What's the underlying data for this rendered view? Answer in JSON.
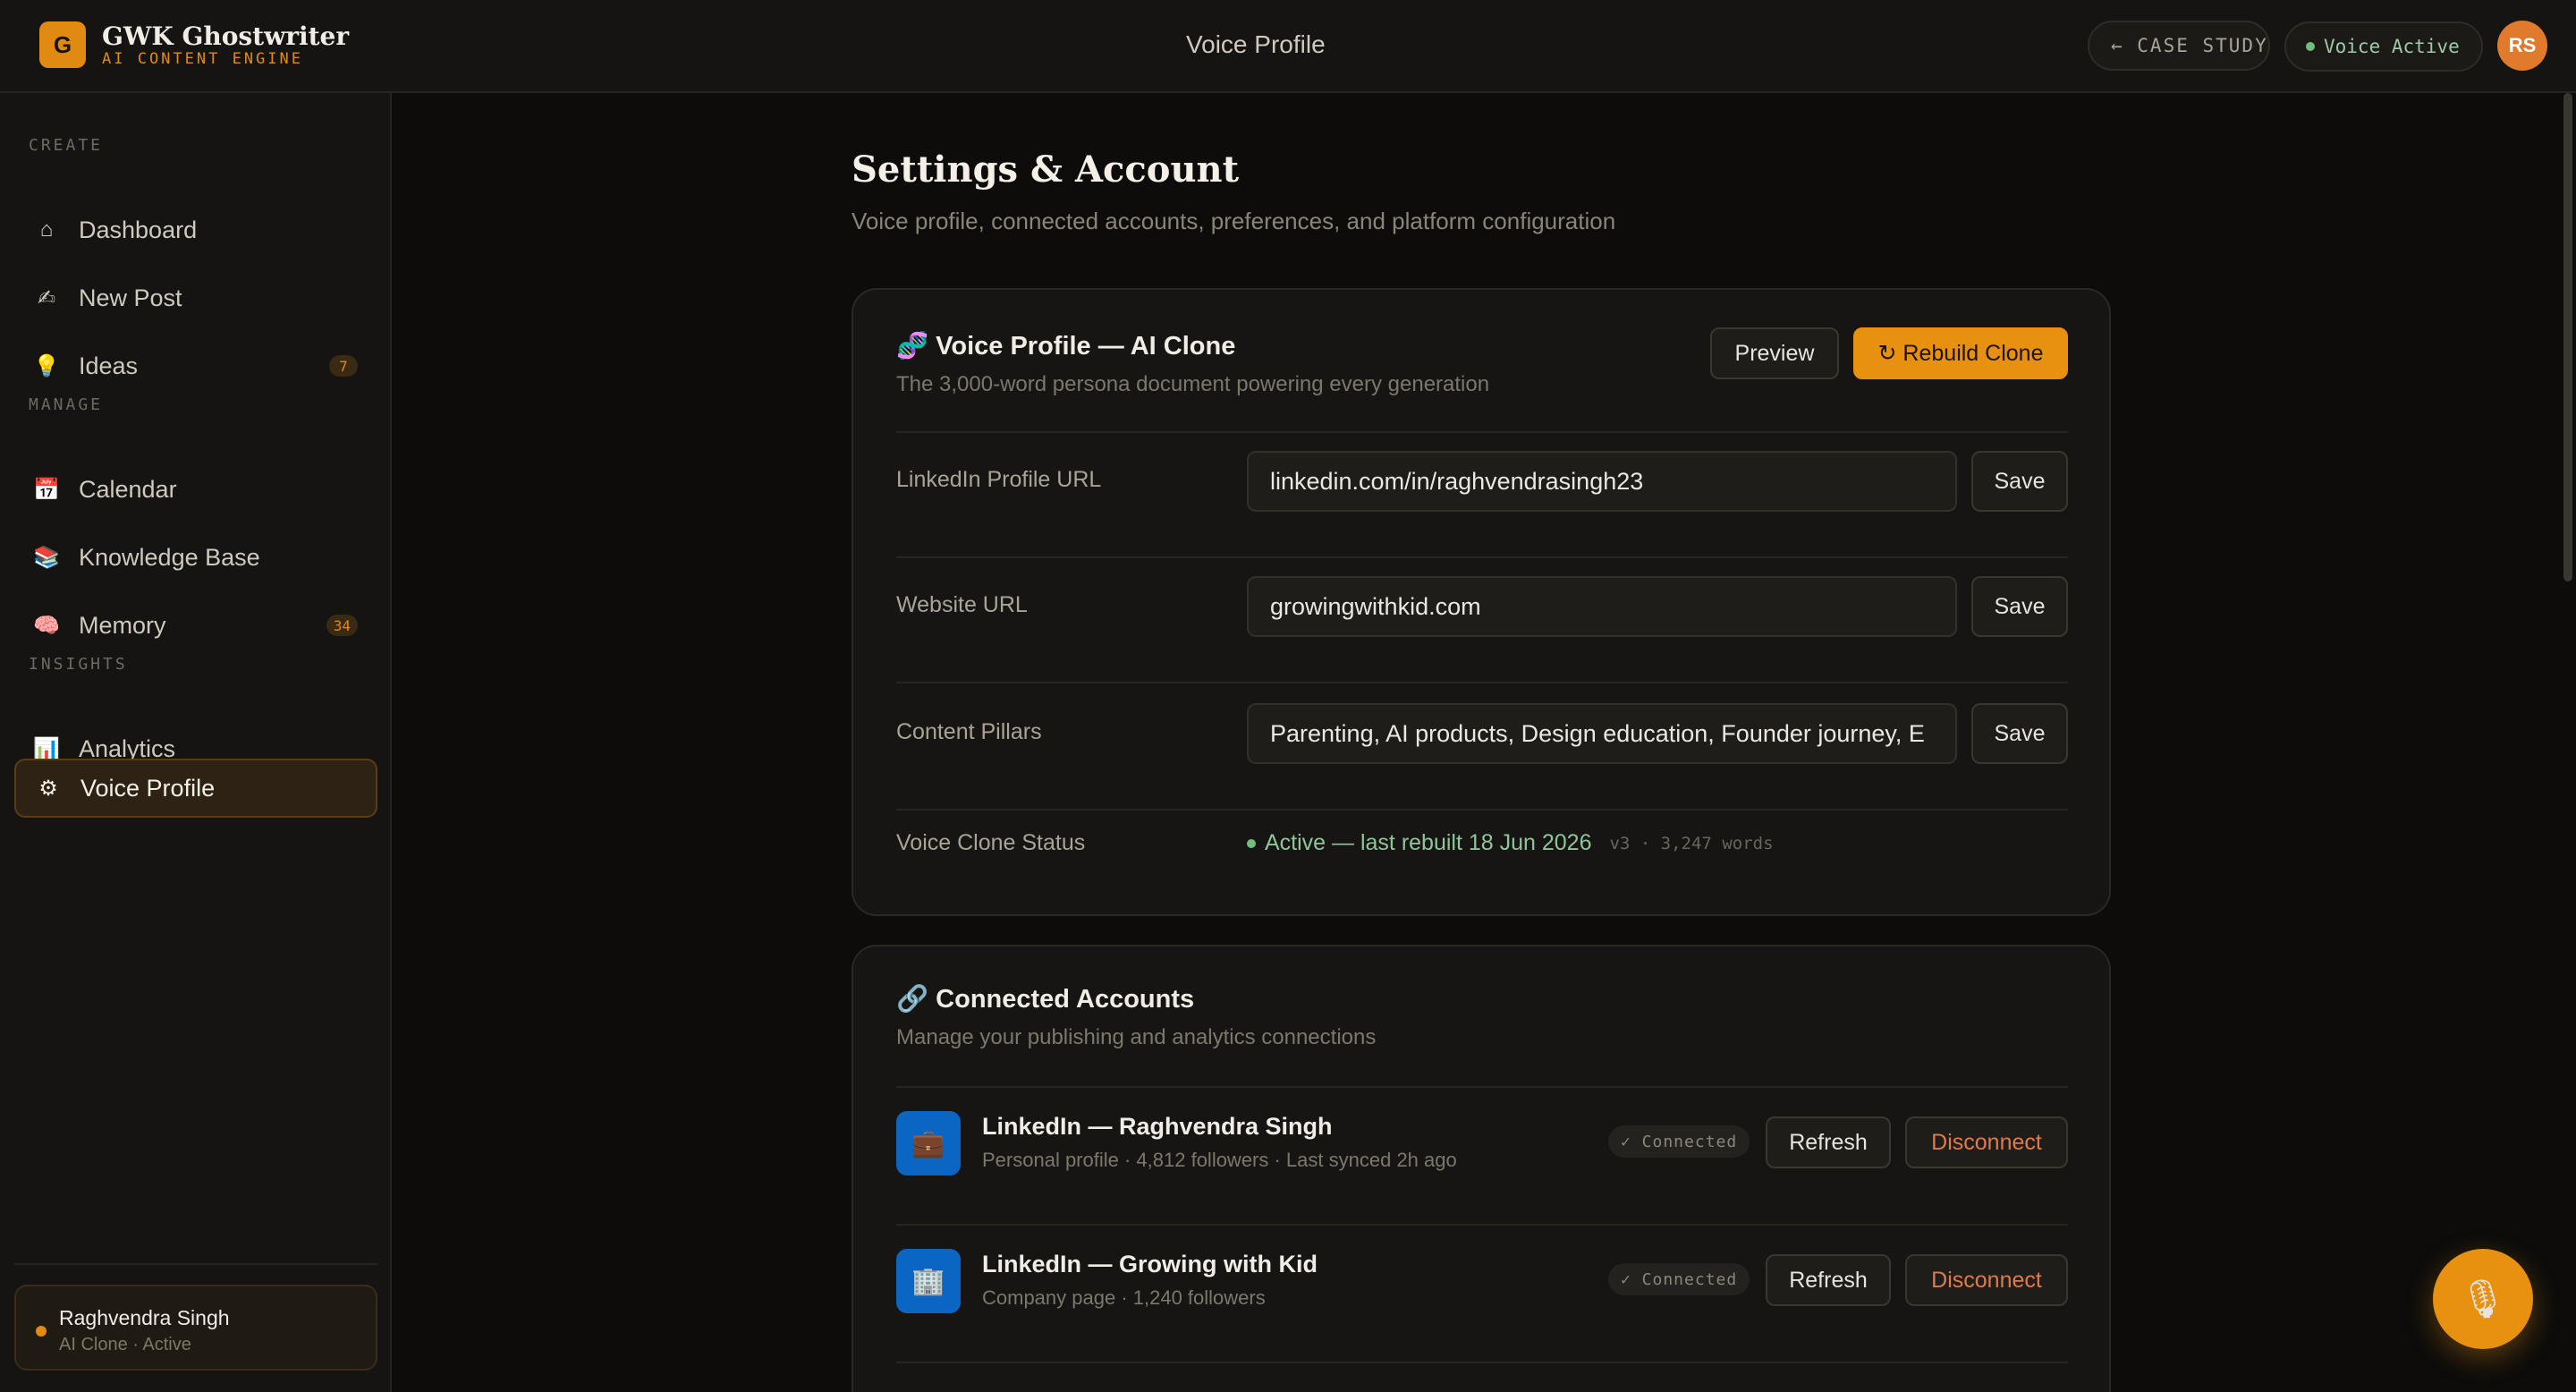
{
  "app": {
    "logo_letter": "G",
    "name": "GWK Ghostwriter",
    "tagline": "AI CONTENT ENGINE",
    "page_title": "Voice Profile",
    "case_study_label": "← CASE STUDY",
    "voice_status_label": "Voice Active",
    "avatar_initials": "RS"
  },
  "sidebar": {
    "sections": [
      {
        "label": "CREATE"
      },
      {
        "label": "MANAGE"
      },
      {
        "label": "INSIGHTS"
      }
    ],
    "items": [
      {
        "label": "Dashboard",
        "icon": "home-icon",
        "glyph": "⌂"
      },
      {
        "label": "New Post",
        "icon": "writing-hand-icon",
        "glyph": "✍"
      },
      {
        "label": "Ideas",
        "icon": "lightbulb-icon",
        "glyph": "💡",
        "badge": "7"
      },
      {
        "label": "Calendar",
        "icon": "calendar-icon",
        "glyph": "📅"
      },
      {
        "label": "Knowledge Base",
        "icon": "books-icon",
        "glyph": "📚"
      },
      {
        "label": "Memory",
        "icon": "brain-icon",
        "glyph": "🧠",
        "badge": "34"
      },
      {
        "label": "Analytics",
        "icon": "bar-chart-icon",
        "glyph": "📊"
      },
      {
        "label": "Voice Profile",
        "icon": "gear-icon",
        "glyph": "⚙",
        "active": true
      }
    ],
    "user": {
      "name": "Raghvendra Singh",
      "status": "AI Clone · Active"
    }
  },
  "main": {
    "title": "Settings & Account",
    "subtitle": "Voice profile, connected accounts, preferences, and platform configuration",
    "voice_card": {
      "icon": "dna-icon",
      "icon_glyph": "🧬",
      "title": "Voice Profile — AI Clone",
      "subtitle": "The 3,000-word persona document powering every generation",
      "preview_label": "Preview",
      "rebuild_label": "↻ Rebuild Clone",
      "fields": [
        {
          "label": "LinkedIn Profile URL",
          "value": "linkedin.com/in/raghvendrasingh23",
          "save_label": "Save"
        },
        {
          "label": "Website URL",
          "value": "growingwithkid.com",
          "save_label": "Save"
        },
        {
          "label": "Content Pillars",
          "value": "Parenting, AI products, Design education, Founder journey, E",
          "save_label": "Save"
        }
      ],
      "status_label": "Voice Clone Status",
      "status_text": "Active — last rebuilt 18 Jun 2026",
      "status_meta": "v3 · 3,247 words"
    },
    "accounts_card": {
      "icon": "link-icon",
      "icon_glyph": "🔗",
      "title": "Connected Accounts",
      "subtitle": "Manage your publishing and analytics connections",
      "accounts": [
        {
          "name": "LinkedIn — Raghvendra Singh",
          "meta": "Personal profile · 4,812 followers · Last synced 2h ago",
          "icon_glyph": "💼",
          "badge": "✓ Connected",
          "refresh_label": "Refresh",
          "disconnect_label": "Disconnect"
        },
        {
          "name": "LinkedIn — Growing with Kid",
          "meta": "Company page · 1,240 followers",
          "icon_glyph": "🏢",
          "badge": "✓ Connected",
          "refresh_label": "Refresh",
          "disconnect_label": "Disconnect"
        }
      ]
    }
  },
  "fab": {
    "icon": "microphone-icon",
    "glyph": "🎙"
  },
  "colors": {
    "accent": "#e8900f",
    "background": "#0d0c0b",
    "success": "#6fbf7f",
    "linkedin": "#0a66c2"
  }
}
